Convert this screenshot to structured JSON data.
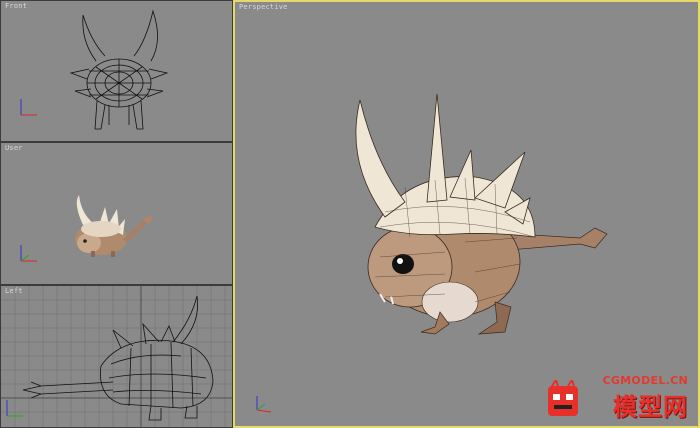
{
  "viewports": {
    "front": {
      "label": "Front"
    },
    "user": {
      "label": "User"
    },
    "left": {
      "label": "Left"
    },
    "perspective": {
      "label": "Perspective"
    }
  },
  "axis_labels": {
    "x": "x",
    "y": "y",
    "z": "z"
  },
  "watermark": {
    "url": "CGMODEL.CN",
    "main": "模型网",
    "color": "#e8302a"
  },
  "colors": {
    "viewport_bg": "#8a8a8a",
    "active_border": "#e6d86a",
    "wireframe": "#111111",
    "creature_body": "#b08a6c",
    "creature_horn": "#efe6d6"
  }
}
